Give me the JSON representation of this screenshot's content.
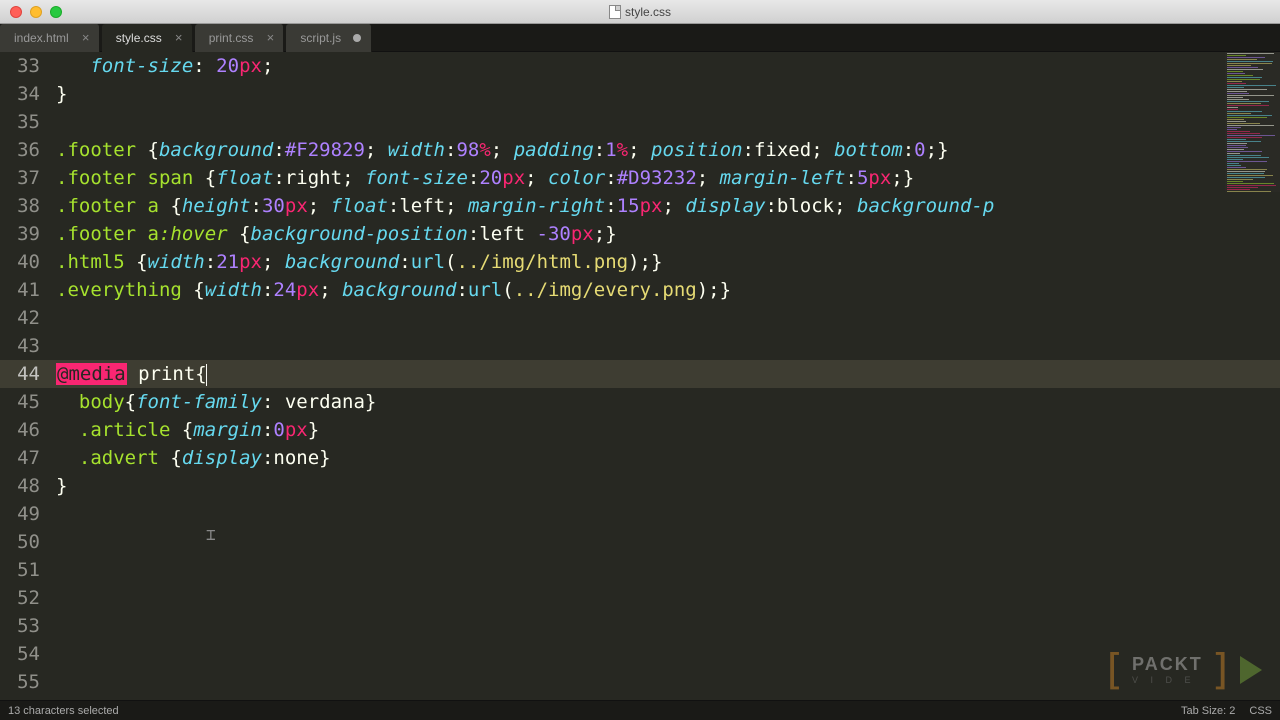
{
  "window": {
    "title": "style.css"
  },
  "tabs": [
    {
      "label": "index.html",
      "active": false,
      "dirty": false
    },
    {
      "label": "style.css",
      "active": true,
      "dirty": false
    },
    {
      "label": "print.css",
      "active": false,
      "dirty": false
    },
    {
      "label": "script.js",
      "active": false,
      "dirty": true
    }
  ],
  "gutter": {
    "start": 33,
    "end": 55,
    "highlight": 44
  },
  "code_lines": [
    {
      "n": 33,
      "t": [
        [
          "",
          "   "
        ],
        [
          "prop",
          "font-size"
        ],
        [
          "punct",
          ": "
        ],
        [
          "num",
          "20"
        ],
        [
          "unit",
          "px"
        ],
        [
          "punct",
          ";"
        ]
      ]
    },
    {
      "n": 34,
      "t": [
        [
          "punct",
          "}"
        ]
      ]
    },
    {
      "n": 35,
      "t": []
    },
    {
      "n": 36,
      "t": [
        [
          "sel",
          ".footer"
        ],
        [
          "",
          " "
        ],
        [
          "punct",
          "{"
        ],
        [
          "prop",
          "background"
        ],
        [
          "punct",
          ":"
        ],
        [
          "num",
          "#F29829"
        ],
        [
          "punct",
          "; "
        ],
        [
          "prop",
          "width"
        ],
        [
          "punct",
          ":"
        ],
        [
          "num",
          "98"
        ],
        [
          "unit",
          "%"
        ],
        [
          "punct",
          "; "
        ],
        [
          "prop",
          "padding"
        ],
        [
          "punct",
          ":"
        ],
        [
          "num",
          "1"
        ],
        [
          "unit",
          "%"
        ],
        [
          "punct",
          "; "
        ],
        [
          "prop",
          "position"
        ],
        [
          "punct",
          ":"
        ],
        [
          "val",
          "fixed"
        ],
        [
          "punct",
          "; "
        ],
        [
          "prop",
          "bottom"
        ],
        [
          "punct",
          ":"
        ],
        [
          "num",
          "0"
        ],
        [
          "punct",
          ";}"
        ]
      ]
    },
    {
      "n": 37,
      "t": [
        [
          "sel",
          ".footer"
        ],
        [
          "",
          " "
        ],
        [
          "sel",
          "span"
        ],
        [
          "",
          " "
        ],
        [
          "punct",
          "{"
        ],
        [
          "prop",
          "float"
        ],
        [
          "punct",
          ":"
        ],
        [
          "val",
          "right"
        ],
        [
          "punct",
          "; "
        ],
        [
          "prop",
          "font-size"
        ],
        [
          "punct",
          ":"
        ],
        [
          "num",
          "20"
        ],
        [
          "unit",
          "px"
        ],
        [
          "punct",
          "; "
        ],
        [
          "prop",
          "color"
        ],
        [
          "punct",
          ":"
        ],
        [
          "num",
          "#D93232"
        ],
        [
          "punct",
          "; "
        ],
        [
          "prop",
          "margin-left"
        ],
        [
          "punct",
          ":"
        ],
        [
          "num",
          "5"
        ],
        [
          "unit",
          "px"
        ],
        [
          "punct",
          ";}"
        ]
      ]
    },
    {
      "n": 38,
      "t": [
        [
          "sel",
          ".footer"
        ],
        [
          "",
          " "
        ],
        [
          "sel",
          "a"
        ],
        [
          "",
          " "
        ],
        [
          "punct",
          "{"
        ],
        [
          "prop",
          "height"
        ],
        [
          "punct",
          ":"
        ],
        [
          "num",
          "30"
        ],
        [
          "unit",
          "px"
        ],
        [
          "punct",
          "; "
        ],
        [
          "prop",
          "float"
        ],
        [
          "punct",
          ":"
        ],
        [
          "val",
          "left"
        ],
        [
          "punct",
          "; "
        ],
        [
          "prop",
          "margin-right"
        ],
        [
          "punct",
          ":"
        ],
        [
          "num",
          "15"
        ],
        [
          "unit",
          "px"
        ],
        [
          "punct",
          "; "
        ],
        [
          "prop",
          "display"
        ],
        [
          "punct",
          ":"
        ],
        [
          "val",
          "block"
        ],
        [
          "punct",
          "; "
        ],
        [
          "prop",
          "background-p"
        ]
      ]
    },
    {
      "n": 39,
      "t": [
        [
          "sel",
          ".footer"
        ],
        [
          "",
          " "
        ],
        [
          "sel",
          "a"
        ],
        [
          "pseudo",
          ":hover"
        ],
        [
          "",
          " "
        ],
        [
          "punct",
          "{"
        ],
        [
          "prop",
          "background-position"
        ],
        [
          "punct",
          ":"
        ],
        [
          "val",
          "left "
        ],
        [
          "num",
          "-30"
        ],
        [
          "unit",
          "px"
        ],
        [
          "punct",
          ";}"
        ]
      ]
    },
    {
      "n": 40,
      "t": [
        [
          "sel",
          ".html5"
        ],
        [
          "",
          " "
        ],
        [
          "punct",
          "{"
        ],
        [
          "prop",
          "width"
        ],
        [
          "punct",
          ":"
        ],
        [
          "num",
          "21"
        ],
        [
          "unit",
          "px"
        ],
        [
          "punct",
          "; "
        ],
        [
          "prop",
          "background"
        ],
        [
          "punct",
          ":"
        ],
        [
          "func",
          "url"
        ],
        [
          "punct",
          "("
        ],
        [
          "str",
          "../img/html.png"
        ],
        [
          "punct",
          ");}"
        ]
      ]
    },
    {
      "n": 41,
      "t": [
        [
          "sel",
          ".everything"
        ],
        [
          "",
          " "
        ],
        [
          "punct",
          "{"
        ],
        [
          "prop",
          "width"
        ],
        [
          "punct",
          ":"
        ],
        [
          "num",
          "24"
        ],
        [
          "unit",
          "px"
        ],
        [
          "punct",
          "; "
        ],
        [
          "prop",
          "background"
        ],
        [
          "punct",
          ":"
        ],
        [
          "func",
          "url"
        ],
        [
          "punct",
          "("
        ],
        [
          "str",
          "../img/every.png"
        ],
        [
          "punct",
          ");}"
        ]
      ]
    },
    {
      "n": 42,
      "t": []
    },
    {
      "n": 43,
      "t": []
    },
    {
      "n": 44,
      "hl": true,
      "t": [
        [
          "kw-bg",
          "@media"
        ],
        [
          "",
          " "
        ],
        [
          "val",
          "print"
        ],
        [
          "punct",
          "{"
        ],
        [
          "cursor",
          ""
        ]
      ]
    },
    {
      "n": 45,
      "t": [
        [
          "",
          "  "
        ],
        [
          "sel",
          "body"
        ],
        [
          "punct",
          "{"
        ],
        [
          "prop",
          "font-family"
        ],
        [
          "punct",
          ": "
        ],
        [
          "val",
          "verdana"
        ],
        [
          "punct",
          "}"
        ]
      ]
    },
    {
      "n": 46,
      "t": [
        [
          "",
          "  "
        ],
        [
          "sel",
          ".article"
        ],
        [
          "",
          " "
        ],
        [
          "punct",
          "{"
        ],
        [
          "prop",
          "margin"
        ],
        [
          "punct",
          ":"
        ],
        [
          "num",
          "0"
        ],
        [
          "unit",
          "px"
        ],
        [
          "punct",
          "}"
        ]
      ]
    },
    {
      "n": 47,
      "t": [
        [
          "",
          "  "
        ],
        [
          "sel",
          ".advert"
        ],
        [
          "",
          " "
        ],
        [
          "punct",
          "{"
        ],
        [
          "prop",
          "display"
        ],
        [
          "punct",
          ":"
        ],
        [
          "val",
          "none"
        ],
        [
          "punct",
          "}"
        ]
      ]
    },
    {
      "n": 48,
      "t": [
        [
          "punct",
          "}"
        ]
      ]
    },
    {
      "n": 49,
      "t": []
    },
    {
      "n": 50,
      "t": []
    },
    {
      "n": 51,
      "t": []
    },
    {
      "n": 52,
      "t": []
    },
    {
      "n": 53,
      "t": []
    },
    {
      "n": 54,
      "t": []
    },
    {
      "n": 55,
      "t": []
    }
  ],
  "status": {
    "left": "13 characters selected",
    "tab_size": "Tab Size: 2",
    "syntax": "CSS"
  },
  "watermark": {
    "line1": "PACKT",
    "line2": "V I D E"
  }
}
